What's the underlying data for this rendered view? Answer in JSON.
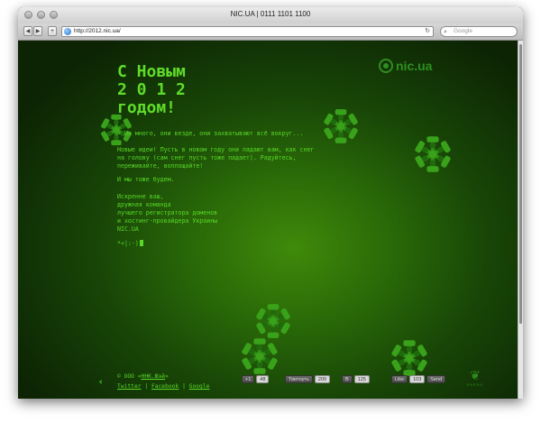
{
  "window": {
    "title": "NIC.UA | 0111 1101 1100"
  },
  "toolbar": {
    "back_icon": "back-arrow-icon",
    "forward_icon": "forward-arrow-icon",
    "url": "http://2012.nic.ua/",
    "search_placeholder": "Google"
  },
  "page": {
    "greeting": [
      "С Новым",
      "2 0 1 2",
      "годом!"
    ],
    "logo": "nic.ua",
    "intro": "> Их много, они везде, они захватывают всё вокруг...",
    "wish": "Новые идеи! Пусть в новом году они падают вам, как снег\nна голову (сам снег пусть тоже падает). Радуйтесь,\nпереживайте, воплощайте!",
    "same": "И мы тоже будем.",
    "sign": "Искренне ваш,\nдружная команда\nлучшего регистратора доменов\nи хостинг-провайдера Украины\nNIC.UA",
    "emoticon": "*<|:-)",
    "copyright": "© ООО «",
    "company": "ННК.Юэй",
    "copyright_end": "»",
    "links": [
      "Twitter",
      "Facebook",
      "Google"
    ],
    "separator": "|"
  },
  "social": {
    "vk_label": "+1",
    "vk_count": "48",
    "tweet_label": "Твитнуть",
    "tweet_count": "209",
    "odnoklassniki_label": "В",
    "odnoklassniki_count": "125",
    "like_label": "Like",
    "like_count": "103",
    "send_label": "Send"
  },
  "brand": {
    "caption": "PAPNO"
  },
  "colors": {
    "text_green": "#58d828",
    "background_dark": "#0c2304",
    "logo_green": "#2e8f20"
  }
}
